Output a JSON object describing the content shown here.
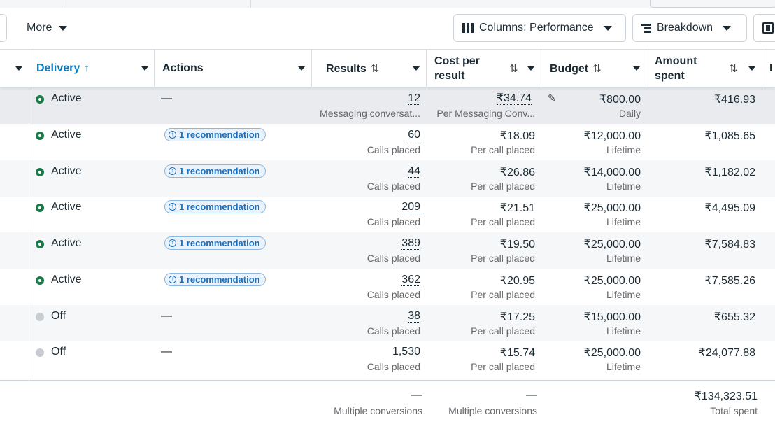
{
  "toolbar": {
    "more_label": "More",
    "columns_label": "Columns: Performance",
    "breakdown_label": "Breakdown"
  },
  "header": {
    "delivery": "Delivery",
    "actions": "Actions",
    "results": "Results",
    "cost_per_result_1": "Cost per",
    "cost_per_result_2": "result",
    "budget": "Budget",
    "amount_spent_1": "Amount",
    "amount_spent_2": "spent",
    "sort_up": "↑",
    "sort_both": "⇅",
    "next_col": "I"
  },
  "rows": [
    {
      "status": "Active",
      "action": "—",
      "results": "12",
      "results_sub": "Messaging conversat...",
      "cost": "₹34.74",
      "cost_sub": "Per Messaging Conv...",
      "budget": "₹800.00",
      "budget_sub": "Daily",
      "spent": "₹416.93"
    },
    {
      "status": "Active",
      "action": "1 recommendation",
      "results": "60",
      "results_sub": "Calls placed",
      "cost": "₹18.09",
      "cost_sub": "Per call placed",
      "budget": "₹12,000.00",
      "budget_sub": "Lifetime",
      "spent": "₹1,085.65"
    },
    {
      "status": "Active",
      "action": "1 recommendation",
      "results": "44",
      "results_sub": "Calls placed",
      "cost": "₹26.86",
      "cost_sub": "Per call placed",
      "budget": "₹14,000.00",
      "budget_sub": "Lifetime",
      "spent": "₹1,182.02"
    },
    {
      "status": "Active",
      "action": "1 recommendation",
      "results": "209",
      "results_sub": "Calls placed",
      "cost": "₹21.51",
      "cost_sub": "Per call placed",
      "budget": "₹25,000.00",
      "budget_sub": "Lifetime",
      "spent": "₹4,495.09"
    },
    {
      "status": "Active",
      "action": "1 recommendation",
      "results": "389",
      "results_sub": "Calls placed",
      "cost": "₹19.50",
      "cost_sub": "Per call placed",
      "budget": "₹25,000.00",
      "budget_sub": "Lifetime",
      "spent": "₹7,584.83"
    },
    {
      "status": "Active",
      "action": "1 recommendation",
      "results": "362",
      "results_sub": "Calls placed",
      "cost": "₹20.95",
      "cost_sub": "Per call placed",
      "budget": "₹25,000.00",
      "budget_sub": "Lifetime",
      "spent": "₹7,585.26"
    },
    {
      "status": "Off",
      "action": "—",
      "results": "38",
      "results_sub": "Calls placed",
      "cost": "₹17.25",
      "cost_sub": "Per call placed",
      "budget": "₹15,000.00",
      "budget_sub": "Lifetime",
      "spent": "₹655.32"
    },
    {
      "status": "Off",
      "action": "—",
      "results": "1,530",
      "results_sub": "Calls placed",
      "cost": "₹15.74",
      "cost_sub": "Per call placed",
      "budget": "₹25,000.00",
      "budget_sub": "Lifetime",
      "spent": "₹24,077.88"
    }
  ],
  "totals": {
    "results": "—",
    "results_sub": "Multiple conversions",
    "cost": "—",
    "cost_sub": "Multiple conversions",
    "spent": "₹134,323.51",
    "spent_sub": "Total spent"
  },
  "colors": {
    "active_dot": "#1c7a4a",
    "off_dot": "#c8ccd0",
    "accent_blue": "#0a78be"
  }
}
